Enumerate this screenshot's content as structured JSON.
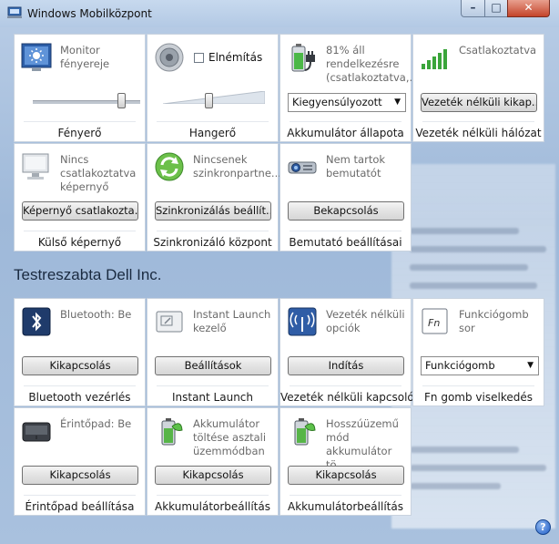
{
  "window": {
    "title": "Windows Mobilközpont",
    "help_glyph": "?"
  },
  "controls": {
    "minimize": "–",
    "maximize": "□",
    "close": "✕"
  },
  "section_title": "Testreszabta Dell Inc.",
  "tiles": {
    "brightness": {
      "desc": "Monitor fényereje",
      "label": "Fényerő",
      "slider_value": 0.82
    },
    "volume": {
      "checkbox_label": "Elnémítás",
      "muted": false,
      "label": "Hangerő",
      "slider_value": 0.45
    },
    "battery": {
      "desc": "81% áll rendelkezésre (csatlakoztatva,...",
      "select_value": "Kiegyensúlyozott",
      "label": "Akkumulátor állapota"
    },
    "wireless": {
      "desc": "Csatlakoztatva",
      "button": "Vezeték nélküli kikap...",
      "label": "Vezeték nélküli hálózat"
    },
    "display": {
      "desc": "Nincs csatlakoztatva képernyő",
      "button": "Képernyő csatlakozta...",
      "label": "Külső képernyő"
    },
    "sync": {
      "desc": "Nincsenek szinkronpartne...",
      "button": "Szinkronizálás beállít...",
      "label": "Szinkronizáló központ"
    },
    "presentation": {
      "desc": "Nem tartok bemutatót",
      "button": "Bekapcsolás",
      "label": "Bemutató beállításai"
    },
    "bluetooth": {
      "desc": "Bluetooth: Be",
      "button": "Kikapcsolás",
      "label": "Bluetooth vezérlés"
    },
    "instant": {
      "desc": "Instant Launch kezelő",
      "button": "Beállítások",
      "label": "Instant Launch"
    },
    "wifi_switch": {
      "desc": "Vezeték nélküli opciók",
      "button": "Indítás",
      "label": "Vezeték nélküli kapcsoló"
    },
    "fn": {
      "icon_text": "Fn",
      "desc": "Funkciógomb sor",
      "select_value": "Funkciógomb",
      "label": "Fn gomb viselkedés"
    },
    "touchpad": {
      "desc": "Érintőpad: Be",
      "button": "Kikapcsolás",
      "label": "Érintőpad beállítása"
    },
    "charge_desktop": {
      "desc": "Akkumulátor töltése asztali üzemmódban ...",
      "button": "Kikapcsolás",
      "label": "Akkumulátorbeállítás"
    },
    "long_life": {
      "desc": "Hosszúüzemű mód akkumulátor tö...",
      "button": "Kikapcsolás",
      "label": "Akkumulátorbeállítás"
    }
  }
}
